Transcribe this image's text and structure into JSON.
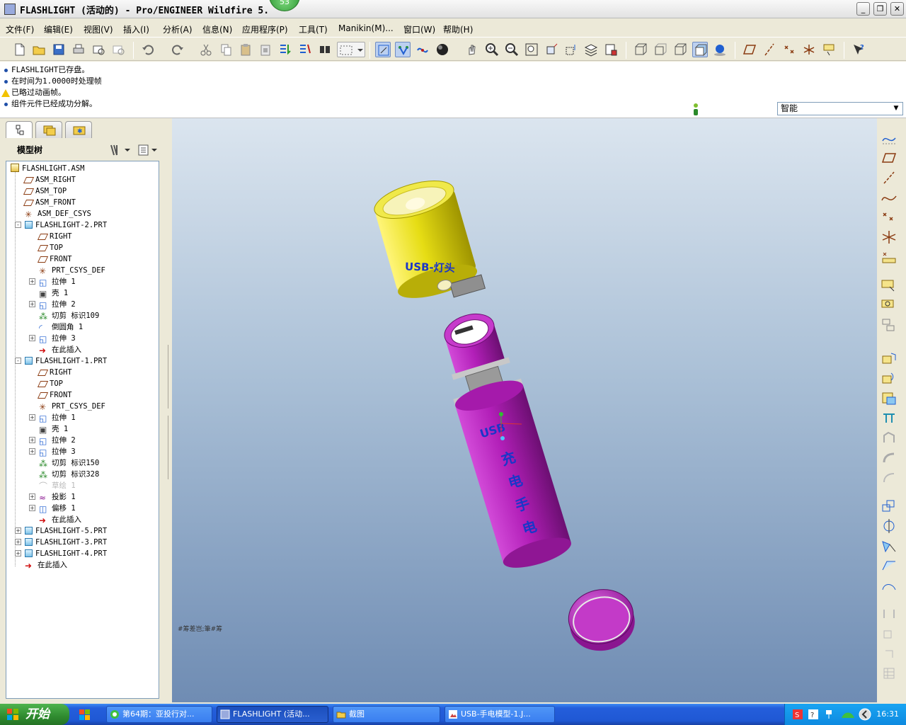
{
  "window": {
    "title": "FLASHLIGHT (活动的) - Pro/ENGINEER Wildfire 5.",
    "badge": "53",
    "min_label": "_",
    "max_label": "❐",
    "close_label": "✕"
  },
  "menu": [
    "文件(F)",
    "编辑(E)",
    "视图(V)",
    "插入(I)",
    "分析(A)",
    "信息(N)",
    "应用程序(P)",
    "工具(T)",
    "Manikin(M)...",
    "窗口(W)",
    "帮助(H)"
  ],
  "messages": [
    {
      "type": "info",
      "text": "FLASHLIGHT已存盘。"
    },
    {
      "type": "info",
      "text": "在时间为1.0000时处理帧"
    },
    {
      "type": "warning",
      "text": "已略过动画帧。"
    },
    {
      "type": "info",
      "text": "组件元件已经成功分解。"
    }
  ],
  "filter": {
    "value": "智能"
  },
  "model_tree": {
    "header": "模型树",
    "nodes": [
      {
        "label": "FLASHLIGHT.ASM",
        "level": 0,
        "icon": "assembly-icon",
        "expander": ""
      },
      {
        "label": "ASM_RIGHT",
        "level": 1,
        "icon": "datum-plane-icon",
        "expander": ""
      },
      {
        "label": "ASM_TOP",
        "level": 1,
        "icon": "datum-plane-icon",
        "expander": ""
      },
      {
        "label": "ASM_FRONT",
        "level": 1,
        "icon": "datum-plane-icon",
        "expander": ""
      },
      {
        "label": "ASM_DEF_CSYS",
        "level": 1,
        "icon": "csys-icon",
        "expander": ""
      },
      {
        "label": "FLASHLIGHT-2.PRT",
        "level": 1,
        "icon": "part-icon",
        "expander": "-"
      },
      {
        "label": "RIGHT",
        "level": 2,
        "icon": "datum-plane-icon",
        "expander": ""
      },
      {
        "label": "TOP",
        "level": 2,
        "icon": "datum-plane-icon",
        "expander": ""
      },
      {
        "label": "FRONT",
        "level": 2,
        "icon": "datum-plane-icon",
        "expander": ""
      },
      {
        "label": "PRT_CSYS_DEF",
        "level": 2,
        "icon": "csys-icon",
        "expander": ""
      },
      {
        "label": "拉伸 1",
        "level": 2,
        "icon": "extrude-icon",
        "expander": "+"
      },
      {
        "label": "壳 1",
        "level": 2,
        "icon": "shell-icon",
        "expander": ""
      },
      {
        "label": "拉伸 2",
        "level": 2,
        "icon": "extrude-icon",
        "expander": "+"
      },
      {
        "label": "切剪 标识109",
        "level": 2,
        "icon": "cut-icon",
        "expander": ""
      },
      {
        "label": "倒圆角 1",
        "level": 2,
        "icon": "round-icon",
        "expander": ""
      },
      {
        "label": "拉伸 3",
        "level": 2,
        "icon": "extrude-icon",
        "expander": "+"
      },
      {
        "label": "在此插入",
        "level": 2,
        "icon": "insert-here-icon",
        "expander": ""
      },
      {
        "label": "FLASHLIGHT-1.PRT",
        "level": 1,
        "icon": "part-icon",
        "expander": "-"
      },
      {
        "label": "RIGHT",
        "level": 2,
        "icon": "datum-plane-icon",
        "expander": ""
      },
      {
        "label": "TOP",
        "level": 2,
        "icon": "datum-plane-icon",
        "expander": ""
      },
      {
        "label": "FRONT",
        "level": 2,
        "icon": "datum-plane-icon",
        "expander": ""
      },
      {
        "label": "PRT_CSYS_DEF",
        "level": 2,
        "icon": "csys-icon",
        "expander": ""
      },
      {
        "label": "拉伸 1",
        "level": 2,
        "icon": "extrude-icon",
        "expander": "+"
      },
      {
        "label": "壳 1",
        "level": 2,
        "icon": "shell-icon",
        "expander": ""
      },
      {
        "label": "拉伸 2",
        "level": 2,
        "icon": "extrude-icon",
        "expander": "+"
      },
      {
        "label": "拉伸 3",
        "level": 2,
        "icon": "extrude-icon",
        "expander": "+"
      },
      {
        "label": "切剪 标识150",
        "level": 2,
        "icon": "cut-icon",
        "expander": ""
      },
      {
        "label": "切剪 标识328",
        "level": 2,
        "icon": "cut-icon",
        "expander": ""
      },
      {
        "label": "草绘 1",
        "level": 2,
        "icon": "sketch-icon",
        "expander": "",
        "dimmed": true
      },
      {
        "label": "投影 1",
        "level": 2,
        "icon": "project-icon",
        "expander": "+"
      },
      {
        "label": "偏移 1",
        "level": 2,
        "icon": "offset-icon",
        "expander": "+"
      },
      {
        "label": "在此插入",
        "level": 2,
        "icon": "insert-here-icon",
        "expander": ""
      },
      {
        "label": "FLASHLIGHT-5.PRT",
        "level": 1,
        "icon": "part-icon",
        "expander": "+"
      },
      {
        "label": "FLASHLIGHT-3.PRT",
        "level": 1,
        "icon": "part-icon",
        "expander": "+"
      },
      {
        "label": "FLASHLIGHT-4.PRT",
        "level": 1,
        "icon": "part-icon",
        "expander": "+"
      },
      {
        "label": "在此插入",
        "level": 1,
        "icon": "insert-here-icon",
        "expander": ""
      }
    ]
  },
  "graphics": {
    "head_label": "USB-灯头",
    "body_label_usb": "USB",
    "body_label_cn": [
      "充",
      "电",
      "手",
      "电"
    ],
    "corner_note": "#筹差岂;筆#筹"
  },
  "taskbar": {
    "start": "开始",
    "tasks": [
      "第64期：亚投行对...",
      "FLASHLIGHT (活动...",
      "截图",
      "USB-手电模型-1.J..."
    ],
    "clock": "16:31"
  },
  "colors": {
    "head": "#e6dd14",
    "body": "#b21fb8",
    "label": "#1a36c8"
  }
}
